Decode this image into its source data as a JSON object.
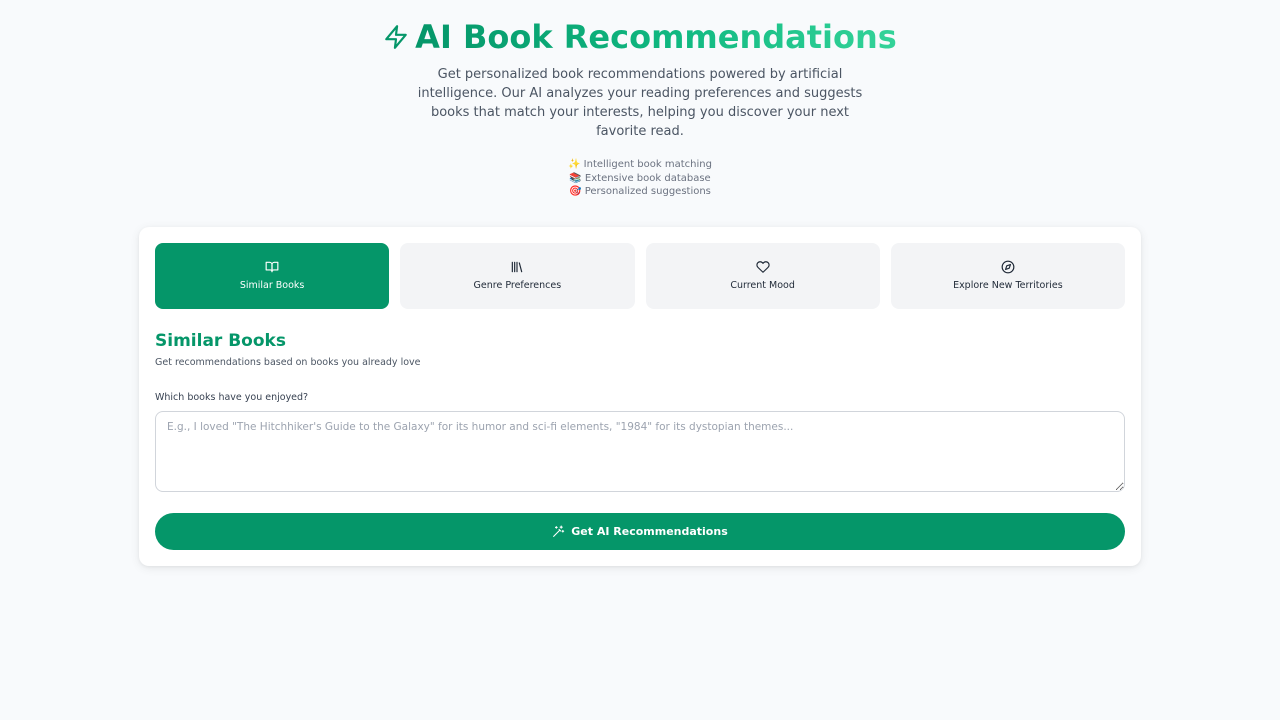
{
  "header": {
    "title": "AI Book Recommendations",
    "title_icon": "lightning-bolt-icon",
    "subtitle": "Get personalized book recommendations powered by artificial intelligence. Our AI analyzes your reading preferences and suggests books that match your interests, helping you discover your next favorite read.",
    "features": [
      "✨ Intelligent book matching",
      "📚 Extensive book database",
      "🎯 Personalized suggestions"
    ]
  },
  "tabs": [
    {
      "label": "Similar Books",
      "icon": "open-book-icon",
      "active": true
    },
    {
      "label": "Genre Preferences",
      "icon": "library-icon",
      "active": false
    },
    {
      "label": "Current Mood",
      "icon": "heart-icon",
      "active": false
    },
    {
      "label": "Explore New Territories",
      "icon": "compass-icon",
      "active": false
    }
  ],
  "section": {
    "title": "Similar Books",
    "description": "Get recommendations based on books you already love"
  },
  "form": {
    "label": "Which books have you enjoyed?",
    "value": "",
    "placeholder": "E.g., I loved \"The Hitchhiker's Guide to the Galaxy\" for its humor and sci-fi elements, \"1984\" for its dystopian themes..."
  },
  "submit": {
    "label": "Get AI Recommendations",
    "icon": "sparkles-wand-icon"
  },
  "colors": {
    "accent": "#059669",
    "accent_light": "#34d399",
    "background": "#f8fafc",
    "tab_inactive": "#f3f4f6"
  }
}
